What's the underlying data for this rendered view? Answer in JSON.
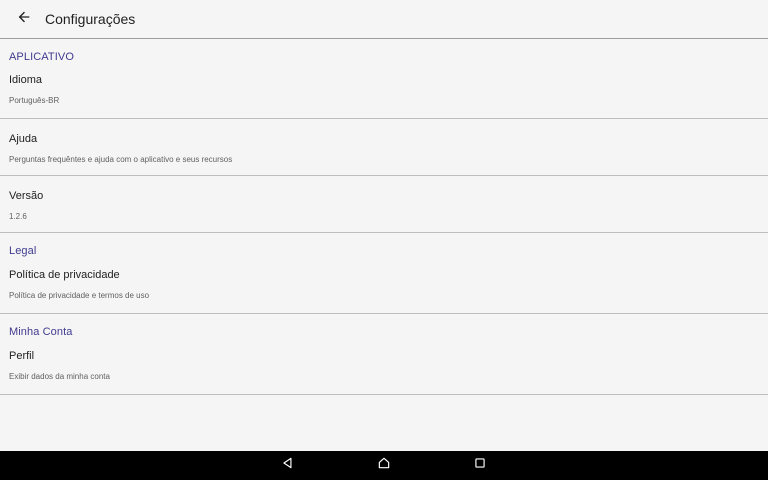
{
  "app_bar": {
    "title": "Configurações",
    "back_icon": "arrow-left-icon"
  },
  "sections": [
    {
      "header": "APLICATIVO",
      "items": [
        {
          "title": "Idioma",
          "summary": "Português-BR"
        },
        {
          "title": "Ajuda",
          "summary": "Perguntas frequêntes e ajuda com o aplicativo e seus recursos"
        },
        {
          "title": "Versão",
          "summary": "1.2.6"
        }
      ]
    },
    {
      "header": "Legal",
      "items": [
        {
          "title": "Política de privacidade",
          "summary": "Política de privacidade e termos de uso"
        }
      ]
    },
    {
      "header": "Minha Conta",
      "items": [
        {
          "title": "Perfil",
          "summary": "Exibir dados da minha conta"
        }
      ]
    }
  ],
  "nav_bar": {
    "icons": [
      "back-triangle-icon",
      "home-icon",
      "recents-square-icon"
    ]
  },
  "colors": {
    "accent": "#3f3b8f",
    "background": "#f5f5f5",
    "nav_bar": "#000000"
  }
}
